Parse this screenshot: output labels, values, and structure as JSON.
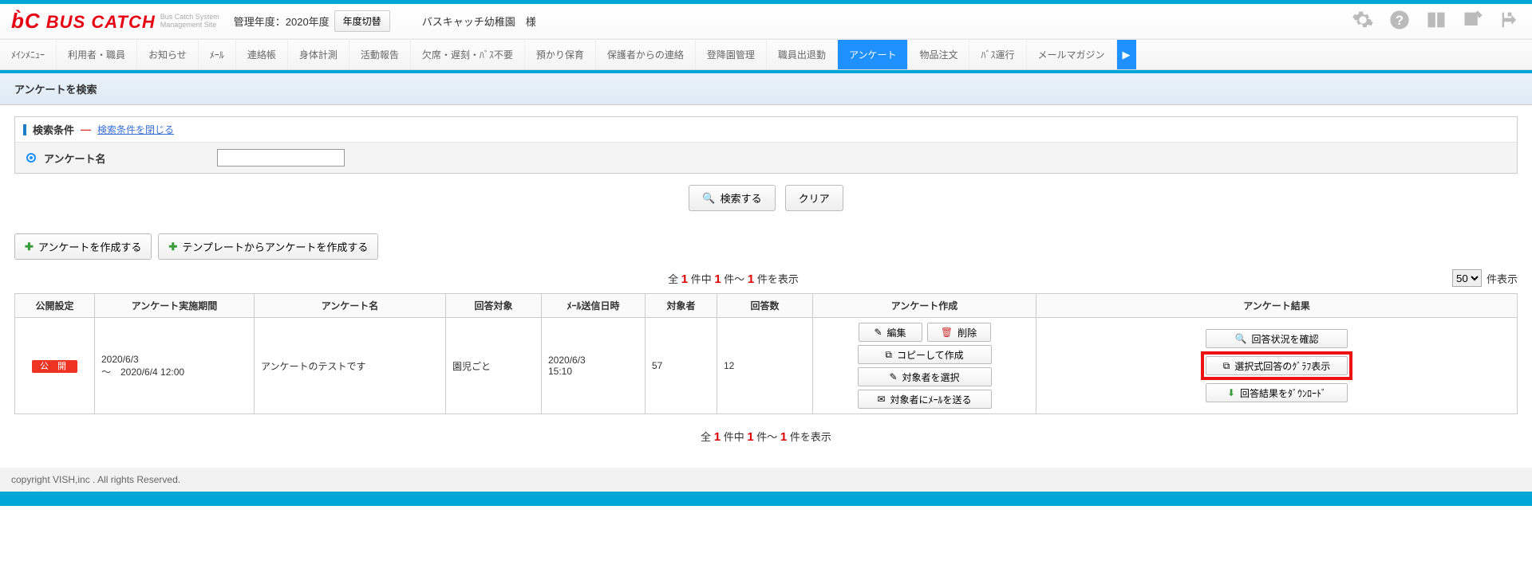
{
  "header": {
    "logo_text": "BUS CATCH",
    "logo_sub1": "Bus Catch System",
    "logo_sub2": "Management Site",
    "year_label": "管理年度：2020年度",
    "year_button": "年度切替",
    "school": "バスキャッチ幼稚園　様"
  },
  "nav": {
    "items": [
      "ﾒｲﾝﾒﾆｭｰ",
      "利用者・職員",
      "お知らせ",
      "ﾒｰﾙ",
      "連絡帳",
      "身体計測",
      "活動報告",
      "欠席・遅刻・ﾊﾞｽ不要",
      "預かり保育",
      "保護者からの連絡",
      "登降園管理",
      "職員出退勤",
      "アンケート",
      "物品注文",
      "ﾊﾞｽ運行",
      "メールマガジン"
    ],
    "active_index": 12
  },
  "page_title": "アンケートを検索",
  "search": {
    "head_title": "検索条件",
    "close_link": "検索条件を閉じる",
    "row_label": "アンケート名",
    "search_btn": "検索する",
    "clear_btn": "クリア"
  },
  "create": {
    "btn1": "アンケートを作成する",
    "btn2": "テンプレートからアンケートを作成する"
  },
  "pager": {
    "prefix": "全 ",
    "n1": "1",
    "mid1": " 件中 ",
    "n2": "1",
    "mid2": " 件～ ",
    "n3": "1",
    "suffix": " 件を表示",
    "per_page_value": "50",
    "per_page_label": "件表示"
  },
  "table": {
    "headers": [
      "公開設定",
      "アンケート実施期間",
      "アンケート名",
      "回答対象",
      "ﾒｰﾙ送信日時",
      "対象者",
      "回答数",
      "アンケート作成",
      "アンケート結果"
    ],
    "row": {
      "publish_badge": "公 開",
      "period_line1": "2020/6/3",
      "period_line2": "～　2020/6/4 12:00",
      "name": "アンケートのテストです",
      "target": "園児ごと",
      "mail_line1": "2020/6/3",
      "mail_line2": "15:10",
      "target_count": "57",
      "answer_count": "12",
      "ops": {
        "edit": "編集",
        "delete": "削除",
        "copy": "コピーして作成",
        "select_target": "対象者を選択",
        "send_mail": "対象者にﾒｰﾙを送る"
      },
      "results": {
        "status": "回答状況を確認",
        "graph": "選択式回答のｸﾞﾗﾌ表示",
        "download": "回答結果をﾀﾞｳﾝﾛｰﾄﾞ"
      }
    }
  },
  "footer": "copyright VISH,inc . All rights Reserved."
}
